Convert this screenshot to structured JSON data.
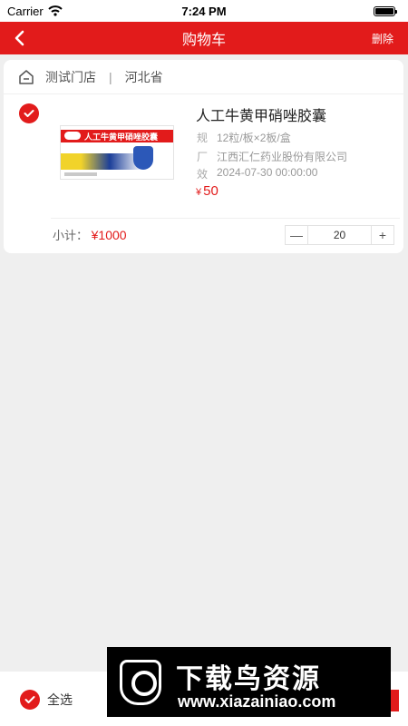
{
  "status_bar": {
    "carrier": "Carrier",
    "time": "7:24 PM"
  },
  "nav": {
    "title": "购物车",
    "delete_label": "删除"
  },
  "store": {
    "name": "测试门店",
    "separator": "|",
    "province": "河北省"
  },
  "cart_item": {
    "name": "人工牛黄甲硝唑胶囊",
    "specs": [
      {
        "label": "规",
        "value": "12粒/板×2板/盒"
      },
      {
        "label": "厂",
        "value": "江西汇仁药业股份有限公司"
      },
      {
        "label": "效",
        "value": "2024-07-30 00:00:00"
      }
    ],
    "currency": "¥",
    "price": "50",
    "subtotal_label": "小计：",
    "subtotal_value": "¥1000",
    "quantity": "20",
    "minus_label": "—",
    "plus_label": "+",
    "box_text": "人工牛黄甲硝唑胶囊"
  },
  "bottom": {
    "select_all_label": "全选"
  },
  "watermark": {
    "title": "下载鸟资源",
    "url": "www.xiazainiao.com"
  },
  "colors": {
    "accent": "#e21b1b",
    "background": "#efefef"
  },
  "icons": {
    "back": "chevron-left-icon",
    "store": "store-home-icon",
    "check": "checkmark-icon",
    "wifi": "wifi-icon",
    "battery": "battery-icon"
  }
}
